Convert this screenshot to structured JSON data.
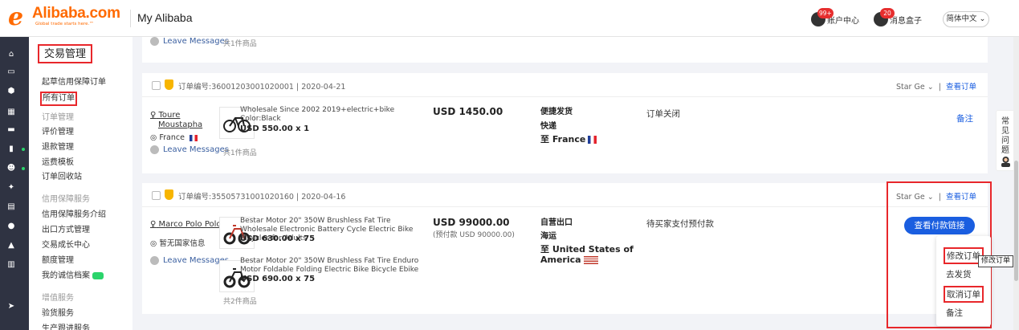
{
  "header": {
    "logo_name": "Alibaba.com",
    "logo_tagline": "Global trade starts here.™",
    "title": "My Alibaba",
    "account_center_label": "账户中心",
    "account_badge": "99+",
    "messages_label": "消息盒子",
    "messages_badge": "20",
    "language": "简体中文"
  },
  "sidebar": {
    "section_title": "交易管理",
    "items": [
      {
        "label": "起草信用保障订单"
      },
      {
        "label": "所有订单",
        "active": true
      },
      {
        "label": "订单管理",
        "group": true
      },
      {
        "label": "评价管理"
      },
      {
        "label": "退款管理"
      },
      {
        "label": "运费模板"
      },
      {
        "label": "订单回收站"
      },
      {
        "label": "信用保障服务",
        "group": true
      },
      {
        "label": "信用保障服务介绍"
      },
      {
        "label": "出口方式管理"
      },
      {
        "label": "交易成长中心"
      },
      {
        "label": "额度管理"
      },
      {
        "label": "我的诚信档案"
      },
      {
        "label": "增值服务",
        "group": true
      },
      {
        "label": "验货服务"
      },
      {
        "label": "生产跟进服务"
      }
    ]
  },
  "orders": [
    {
      "partial": true,
      "leave_messages": "Leave Messages",
      "item_count": "共1件商品"
    },
    {
      "order_meta": "订单编号:36001203001020001  |  2020-04-21",
      "assignee": "Star Ge",
      "view_order": "查看订单",
      "buyer_name_line1": "Toure",
      "buyer_name_line2": "Moustapha",
      "buyer_location": "France",
      "leave_messages": "Leave Messages",
      "item_count": "共1件商品",
      "products": [
        {
          "name": "Wholesale Since 2002 2019+electric+bike",
          "spec": "Color:Black",
          "price": "USD 550.00 x 1"
        }
      ],
      "amount": "USD 1450.00",
      "shipping_method": "便捷发货",
      "shipping_mode": "快递",
      "destination": "至 France",
      "status": "订单关闭",
      "remark": "备注"
    },
    {
      "order_meta": "订单编号:35505731001020160  |  2020-04-16",
      "assignee": "Star Ge",
      "view_order": "查看订单",
      "buyer_name_line1": "Marco Polo Polo",
      "buyer_location": "暂无国家信息",
      "leave_messages": "Leave Messages",
      "item_count": "共2件商品",
      "products": [
        {
          "name": "Bestar Motor 20\" 350W Brushless Fat Tire Wholesale Electronic Battery Cycle Electric Bike Bicycles for Adults",
          "price": "USD 630.00 x 75"
        },
        {
          "name": "Bestar Motor 20\" 350W Brushless Fat Tire Enduro Motor Foldable Folding Electric Bike Bicycle Ebike",
          "price": "USD 690.00 x 75"
        }
      ],
      "amount": "USD 99000.00",
      "amount_sub": "(预付款 USD 90000.00)",
      "shipping_method": "自营出口",
      "shipping_mode": "海运",
      "destination": "至 United States of America",
      "status": "待买家支付预付款",
      "pay_button": "查看付款链接"
    }
  ],
  "dropdown": {
    "items": [
      "修改订单",
      "去发货",
      "取消订单",
      "备注"
    ],
    "tooltip": "修改订单"
  },
  "faq": {
    "label": "常见问题"
  }
}
